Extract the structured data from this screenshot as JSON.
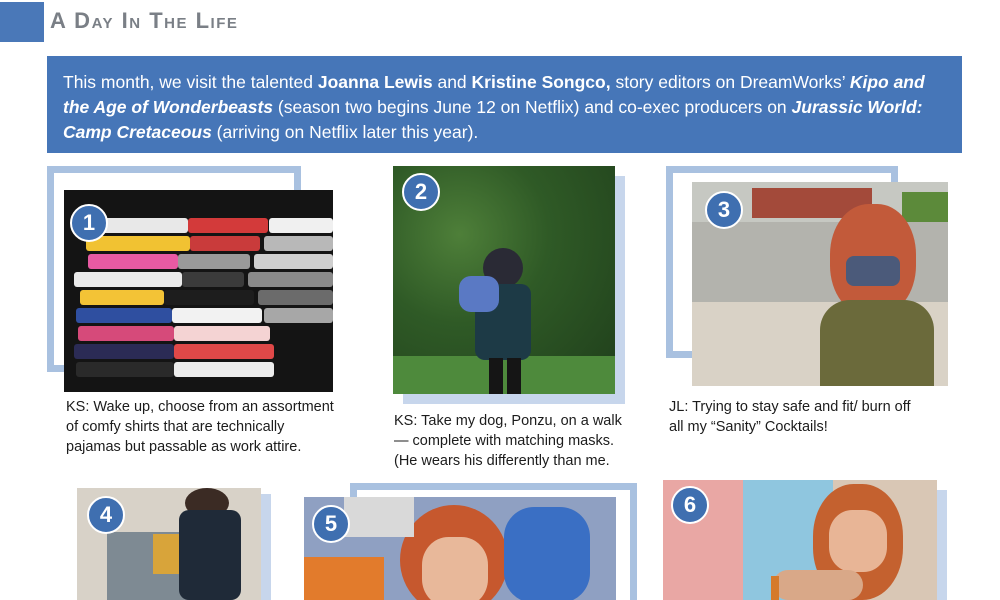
{
  "header": {
    "title": "A Day In The Life"
  },
  "intro": {
    "part1": "This month, we visit the talented ",
    "name1": "Joanna Lewis",
    "part2": " and ",
    "name2": "Kristine Songco,",
    "part3": " story editors on DreamWorks’ ",
    "show1": "Kipo and the Age of Wonderbeasts",
    "part4": " (season two begins June 12 on Netflix) and co-exec producers on ",
    "show2": "Jurassic World: Camp Cretaceous",
    "part5": " (arriving on Netflix later this year)."
  },
  "photos": [
    {
      "number": "1",
      "caption": "KS: Wake up, choose from an assortment of comfy shirts that are technically pajamas but passable as work attire."
    },
    {
      "number": "2",
      "caption": "KS: Take my dog, Ponzu, on a walk — complete with matching masks. (He wears his differently than me."
    },
    {
      "number": "3",
      "caption": "JL: Trying to stay safe and fit/ burn off all my “Sanity” Cocktails!"
    },
    {
      "number": "4"
    },
    {
      "number": "5"
    },
    {
      "number": "6"
    }
  ],
  "colors": {
    "accent": "#4676b8",
    "frame": "#a9c1e0",
    "badge": "#3f6fb0"
  }
}
